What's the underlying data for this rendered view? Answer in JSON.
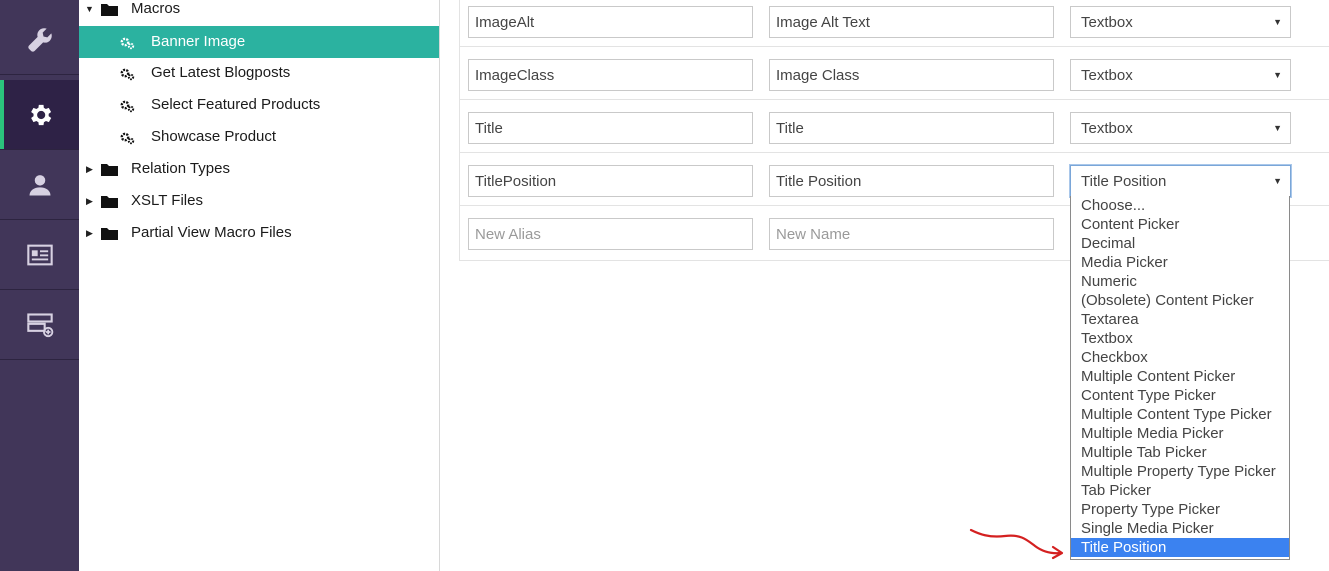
{
  "rail": {
    "items": [
      {
        "name": "wrench-icon",
        "active": false
      },
      {
        "name": "gear-icon",
        "active": true
      },
      {
        "name": "user-icon",
        "active": false
      },
      {
        "name": "id-card-icon",
        "active": false
      },
      {
        "name": "form-add-icon",
        "active": false
      }
    ]
  },
  "tree": {
    "macros": "Macros",
    "items": [
      "Banner Image",
      "Get Latest Blogposts",
      "Select Featured Products",
      "Showcase Product"
    ],
    "folders": [
      "Relation Types",
      "XSLT Files",
      "Partial View Macro Files"
    ]
  },
  "properties": [
    {
      "alias": "ImageAlt",
      "name": "Image Alt Text",
      "type": "Textbox"
    },
    {
      "alias": "ImageClass",
      "name": "Image Class",
      "type": "Textbox"
    },
    {
      "alias": "Title",
      "name": "Title",
      "type": "Textbox"
    },
    {
      "alias": "TitlePosition",
      "name": "Title Position",
      "type": "Title Position"
    }
  ],
  "new_row": {
    "alias_placeholder": "New Alias",
    "name_placeholder": "New Name"
  },
  "dropdown": {
    "options": [
      "Choose...",
      "Content Picker",
      "Decimal",
      "Media Picker",
      "Numeric",
      "(Obsolete) Content Picker",
      "Textarea",
      "Textbox",
      "Checkbox",
      "Multiple Content Picker",
      "Content Type Picker",
      "Multiple Content Type Picker",
      "Multiple Media Picker",
      "Multiple Tab Picker",
      "Multiple Property Type Picker",
      "Tab Picker",
      "Property Type Picker",
      "Single Media Picker",
      "Title Position"
    ],
    "highlighted": "Title Position"
  },
  "colors": {
    "rail": "#413659",
    "selected_node": "#2bb2a0",
    "highlight": "#3b82f0",
    "annotation": "#d42020"
  }
}
